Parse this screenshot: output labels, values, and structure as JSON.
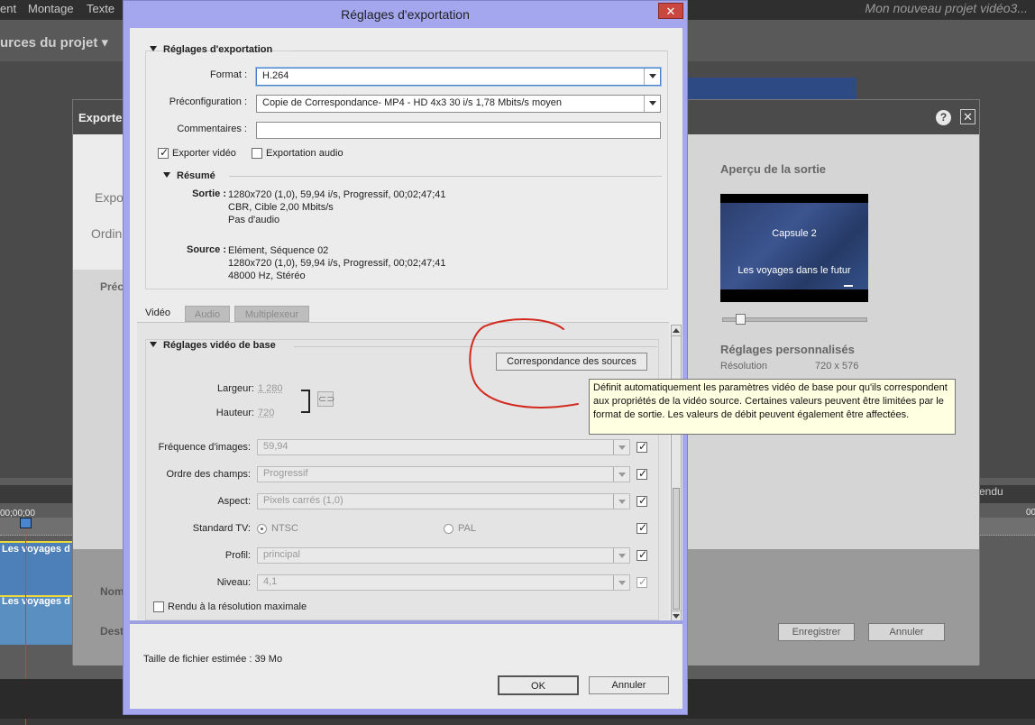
{
  "app": {
    "menu": [
      "ent",
      "Montage",
      "Texte"
    ],
    "project_title": "Mon nouveau projet vidéo3...",
    "sources_tab": "urces du projet",
    "timeline_timecode": "00;00;00",
    "timeline_timecode_right": "00",
    "render_label": "endu",
    "clip1": "Les voyages d",
    "clip2": "Les voyages d"
  },
  "export_dialog": {
    "title": "Exporte",
    "left_tab_1": "Expo",
    "left_tab_2": "Ordin",
    "left_label": "Préc",
    "help_icon": "?",
    "close_icon": "✕",
    "preview_title": "Aperçu de la sortie",
    "preview_caption_1": "Capsule 2",
    "preview_caption_2": "Les voyages dans le futur",
    "preview_slider_value": 0.1,
    "custom_settings_title": "Réglages personnalisés",
    "resolution_label": "Résolution",
    "resolution_value": "720 x 576",
    "name_label": "Nom",
    "dest_label": "Dest",
    "save_button": "Enregistrer",
    "cancel_button": "Annuler"
  },
  "dialog": {
    "title": "Réglages d'exportation",
    "close_icon": "✕",
    "export_group": {
      "title": "Réglages d'exportation",
      "format_label": "Format :",
      "format_value": "H.264",
      "preset_label": "Préconfiguration :",
      "preset_value": "Copie de Correspondance- MP4 - HD 4x3 30 i/s 1,78 Mbits/s moyen",
      "comments_label": "Commentaires :",
      "comments_value": "",
      "export_video_label": "Exporter vidéo",
      "export_video_checked": true,
      "export_audio_label": "Exportation audio",
      "export_audio_checked": false
    },
    "summary": {
      "title": "Résumé",
      "output_label": "Sortie :",
      "output_lines": [
        "1280x720 (1,0), 59,94 i/s, Progressif, 00;02;47;41",
        "CBR, Cible 2,00 Mbits/s",
        "Pas d'audio"
      ],
      "source_label": "Source :",
      "source_lines": [
        "Elément, Séquence 02",
        "1280x720 (1,0), 59,94 i/s, Progressif, 00;02;47;41",
        "48000 Hz, Stéréo"
      ]
    },
    "tabs": [
      "Vidéo",
      "Audio",
      "Multiplexeur"
    ],
    "video_basic": {
      "title": "Réglages vidéo de base",
      "match_source_button": "Correspondance des sources",
      "width_label": "Largeur:",
      "width_value": "1 280",
      "height_label": "Hauteur:",
      "height_value": "720",
      "link_icon": "⊂⊃",
      "framerate_label": "Fréquence d'images:",
      "framerate_value": "59,94",
      "field_order_label": "Ordre des champs:",
      "field_order_value": "Progressif",
      "aspect_label": "Aspect:",
      "aspect_value": "Pixels carrés (1,0)",
      "tv_standard_label": "Standard TV:",
      "tv_ntsc": "NTSC",
      "tv_pal": "PAL",
      "profile_label": "Profil:",
      "profile_value": "principal",
      "level_label": "Niveau:",
      "level_value": "4,1",
      "max_render_label": "Rendu à la résolution maximale"
    },
    "file_size": "Taille de fichier estimée : 39 Mo",
    "ok_button": "OK",
    "cancel_button": "Annuler"
  },
  "tooltip": {
    "text": "Définit automatiquement les paramètres vidéo de base pour qu'ils correspondent aux propriétés de la vidéo source. Certaines valeurs peuvent être limitées par le format de sortie. Les valeurs de débit peuvent également être affectées."
  },
  "colors": {
    "dialog_frame": "#a4a6ee",
    "annotation_circle": "#d32a1f",
    "tooltip_bg": "#ffffe1"
  }
}
